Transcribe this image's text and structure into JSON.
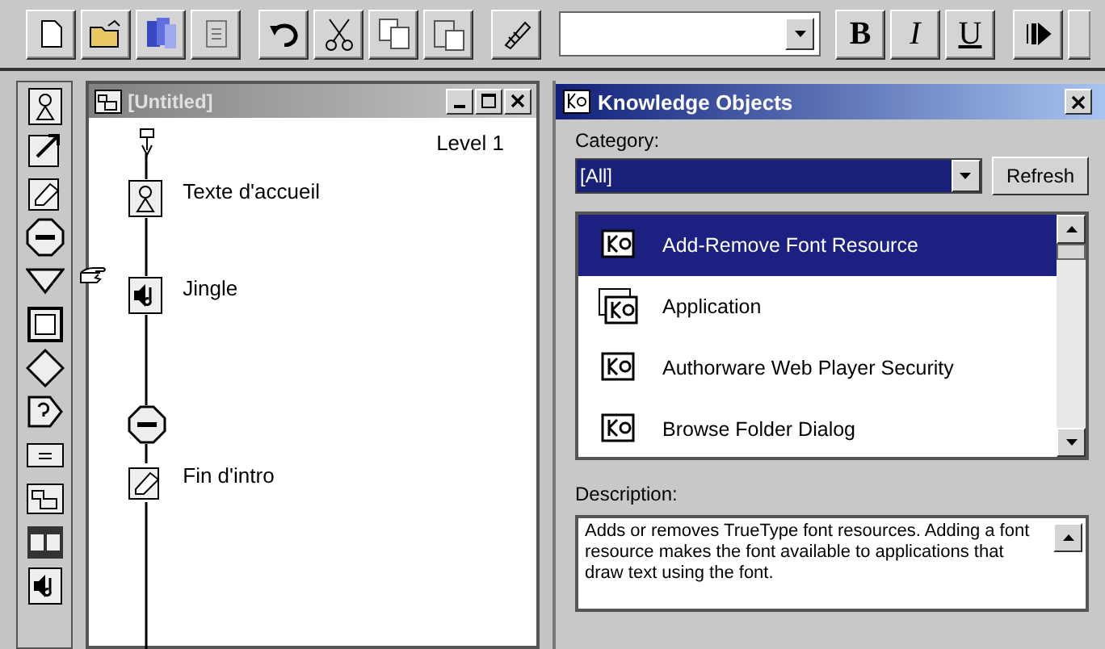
{
  "toolbar": {
    "buttons": [
      {
        "kind": "new"
      },
      {
        "kind": "open"
      },
      {
        "kind": "library"
      },
      {
        "kind": "import"
      },
      {
        "kind": "undo"
      },
      {
        "kind": "cut"
      },
      {
        "kind": "copy"
      },
      {
        "kind": "paste"
      },
      {
        "kind": "style"
      }
    ],
    "font_style_buttons": [
      {
        "label": "B",
        "kind": "bold"
      },
      {
        "label": "I",
        "kind": "italic"
      },
      {
        "label": "U",
        "kind": "underline"
      }
    ]
  },
  "flowline": {
    "title": "[Untitled]",
    "level": "Level 1",
    "nodes": [
      {
        "kind": "display",
        "label": "Texte d'accueil",
        "paste_point": false
      },
      {
        "kind": "sound",
        "label": "Jingle",
        "paste_point": true
      },
      {
        "kind": "wait",
        "paste_point": false
      },
      {
        "kind": "erase",
        "label": "Fin d'intro",
        "paste_point": false
      }
    ]
  },
  "knowledge_objects": {
    "title": "Knowledge Objects",
    "category_label": "Category:",
    "category_value": "[All]",
    "refresh_button": "Refresh",
    "items": [
      {
        "label": "Add-Remove Font Resource",
        "selected": true,
        "kind": "single"
      },
      {
        "label": "Application",
        "selected": false,
        "kind": "stack"
      },
      {
        "label": "Authorware Web Player Security",
        "selected": false,
        "kind": "single"
      },
      {
        "label": "Browse Folder Dialog",
        "selected": false,
        "kind": "single"
      }
    ],
    "description_label": "Description:",
    "description": "Adds or removes TrueType font resources. Adding a font resource makes the font available to applications that draw text using the font."
  }
}
